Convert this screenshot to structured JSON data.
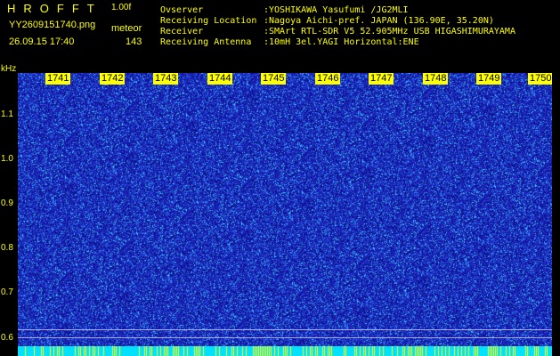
{
  "header": {
    "app_name": "HROFFT",
    "version": "1.00f",
    "filename": "YY2609151740.png",
    "event_type": "meteor",
    "datetime": "26.09.15 17:40",
    "count": "143"
  },
  "info": [
    {
      "key": "Ovserver",
      "value": ":YOSHIKAWA Yasufumi /JG2MLI"
    },
    {
      "key": "Receiving Location",
      "value": ":Nagoya Aichi-pref. JAPAN (136.90E, 35.20N)"
    },
    {
      "key": "Receiver",
      "value": ":SMArt RTL-SDR V5 52.905MHz USB HIGASHIMURAYAMA"
    },
    {
      "key": "Receiving Antenna",
      "value": ":10mH 3el.YAGI Horizontal:ENE"
    }
  ],
  "plot": {
    "y_unit": "kHz",
    "y_ticks": [
      "1.1",
      "1.0",
      "0.9",
      "0.8",
      "0.7",
      "0.6"
    ],
    "time_ticks": [
      "1741",
      "1742",
      "1743",
      "1744",
      "1745",
      "1746",
      "1747",
      "1748",
      "1749",
      "1750"
    ]
  },
  "colors": {
    "background": "#000000",
    "text": "#ffff00",
    "waterfall_base": "#1418a8",
    "noise_bright": "#40c8ff",
    "noise_mid": "#3048e0",
    "bottom_bar": "#00e0ff"
  }
}
